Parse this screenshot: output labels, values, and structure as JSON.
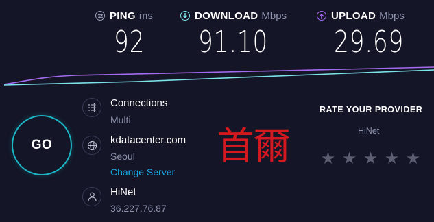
{
  "ping": {
    "label": "PING",
    "unit": "ms",
    "value": "92"
  },
  "download": {
    "label": "DOWNLOAD",
    "unit": "Mbps",
    "value": "91.10"
  },
  "upload": {
    "label": "UPLOAD",
    "unit": "Mbps",
    "value": "29.69"
  },
  "go_button": {
    "label": "GO"
  },
  "connections": {
    "title": "Connections",
    "value": "Multi",
    "icon": "connections-icon"
  },
  "server": {
    "host": "kdatacenter.com",
    "city": "Seoul",
    "change_label": "Change Server",
    "icon": "globe-icon"
  },
  "client": {
    "isp": "HiNet",
    "ip": "36.227.76.87",
    "icon": "person-icon"
  },
  "watermark": "首爾",
  "rating": {
    "title": "RATE YOUR PROVIDER",
    "provider": "HiNet",
    "stars": 5,
    "filled": 0
  },
  "colors": {
    "accent_go": "#1bb7c7",
    "download": "#7de3ea",
    "upload": "#a46bf0",
    "link": "#1aa6e6",
    "watermark": "#d4181f"
  }
}
